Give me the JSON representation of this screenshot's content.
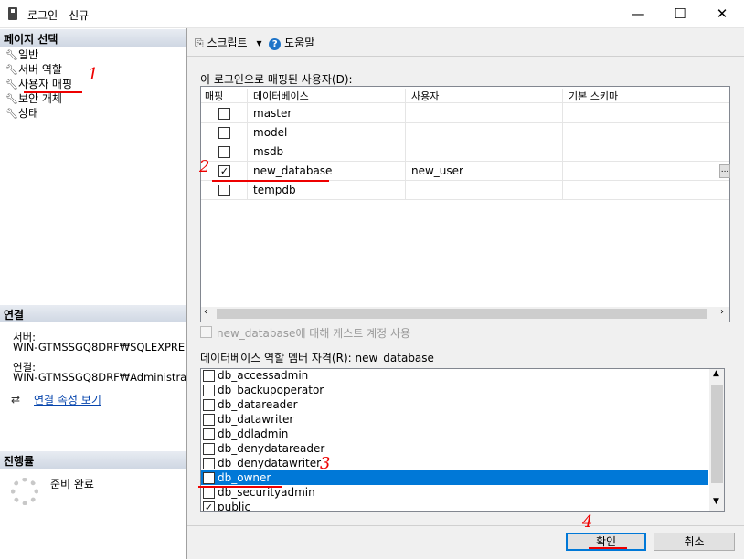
{
  "window": {
    "title": "로그인 - 신규",
    "controls": {
      "minimize": "—",
      "maximize": "☐",
      "close": "✕"
    }
  },
  "left": {
    "pages_header": "페이지 선택",
    "pages": [
      "일반",
      "서버 역할",
      "사용자 매핑",
      "보안 개체",
      "상태"
    ],
    "connection_header": "연결",
    "server_label": "서버:",
    "server_value": "WIN-GTMSSGQ8DRF₩SQLEXPRE",
    "connection_label": "연결:",
    "connection_value": "WIN-GTMSSGQ8DRF₩Administrat",
    "view_props_link": "연결 속성 보기",
    "progress_header": "진행률",
    "progress_status": "준비 완료"
  },
  "toolbar": {
    "script_label": "스크립트",
    "script_dropdown": "▾",
    "help_label": "도움말"
  },
  "mapping": {
    "section_label": "이 로그인으로 매핑된 사용자(D):",
    "columns": [
      "매핑",
      "데이터베이스",
      "사용자",
      "기본 스키마"
    ],
    "rows": [
      {
        "mapped": false,
        "database": "master",
        "user": ""
      },
      {
        "mapped": false,
        "database": "model",
        "user": ""
      },
      {
        "mapped": false,
        "database": "msdb",
        "user": ""
      },
      {
        "mapped": true,
        "database": "new_database",
        "user": "new_user"
      },
      {
        "mapped": false,
        "database": "tempdb",
        "user": ""
      }
    ],
    "ellipsis": "...",
    "guest_label": "new_database에 대해 게스트 계정 사용"
  },
  "roles": {
    "section_label": "데이터베이스 역할 멤버 자격(R): new_database",
    "items": [
      {
        "name": "db_accessadmin",
        "checked": false,
        "selected": false
      },
      {
        "name": "db_backupoperator",
        "checked": false,
        "selected": false
      },
      {
        "name": "db_datareader",
        "checked": false,
        "selected": false
      },
      {
        "name": "db_datawriter",
        "checked": false,
        "selected": false
      },
      {
        "name": "db_ddladmin",
        "checked": false,
        "selected": false
      },
      {
        "name": "db_denydatareader",
        "checked": false,
        "selected": false
      },
      {
        "name": "db_denydatawriter",
        "checked": false,
        "selected": false
      },
      {
        "name": "db_owner",
        "checked": true,
        "selected": true
      },
      {
        "name": "db_securityadmin",
        "checked": false,
        "selected": false
      },
      {
        "name": "public",
        "checked": true,
        "selected": false
      }
    ]
  },
  "buttons": {
    "ok": "확인",
    "cancel": "취소"
  },
  "annotations": {
    "n1": "1",
    "n2": "2",
    "n3": "3",
    "n4": "4"
  },
  "icons": {
    "wrench": "wrench-icon",
    "script": "script-icon",
    "help": "help-icon",
    "link": "connection-icon"
  }
}
